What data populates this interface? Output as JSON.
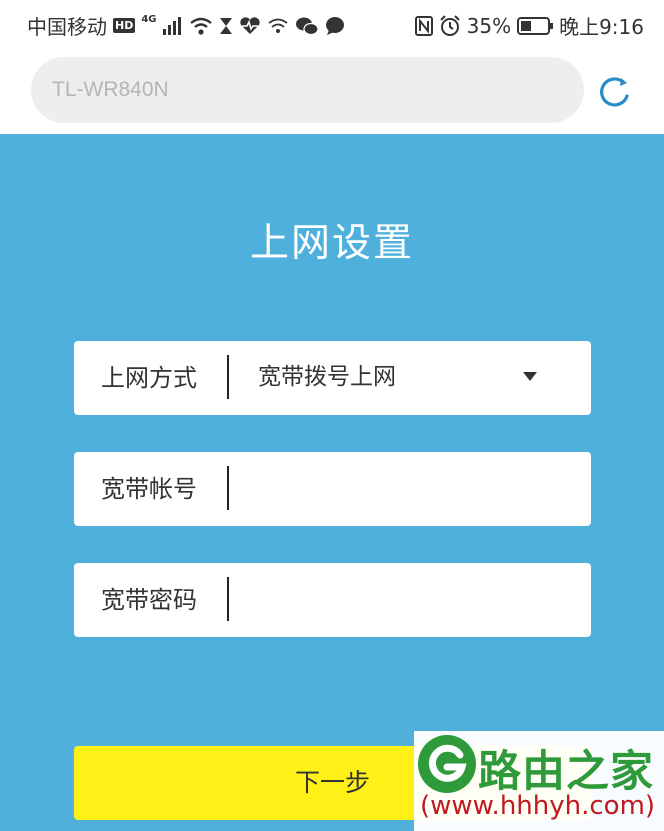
{
  "status_bar": {
    "carrier": "中国移动",
    "hd_badge": "HD",
    "network_type": "4G",
    "battery_percent": "35%",
    "time": "晚上9:16",
    "icons": [
      "signal-icon",
      "wifi-icon",
      "hourglass-icon",
      "heart-rate-icon",
      "wifi-share-icon",
      "wechat-icon",
      "chat-bubble-icon",
      "nfc-icon",
      "alarm-icon",
      "battery-icon"
    ]
  },
  "address_bar": {
    "url": "TL-WR840N",
    "reload_icon": "reload-icon"
  },
  "page": {
    "title": "上网设置",
    "fields": [
      {
        "label": "上网方式",
        "value": "宽带拨号上网",
        "type": "select"
      },
      {
        "label": "宽带帐号",
        "value": "",
        "type": "text"
      },
      {
        "label": "宽带密码",
        "value": "",
        "type": "password"
      }
    ],
    "next_button": "下一步"
  },
  "watermark": {
    "brand": "路由之家",
    "url": "(www.hhhyh.com)"
  },
  "colors": {
    "background": "#4fb0dc",
    "button": "#fff018",
    "watermark_green": "#2e9a3a",
    "watermark_red": "#c0191f"
  }
}
